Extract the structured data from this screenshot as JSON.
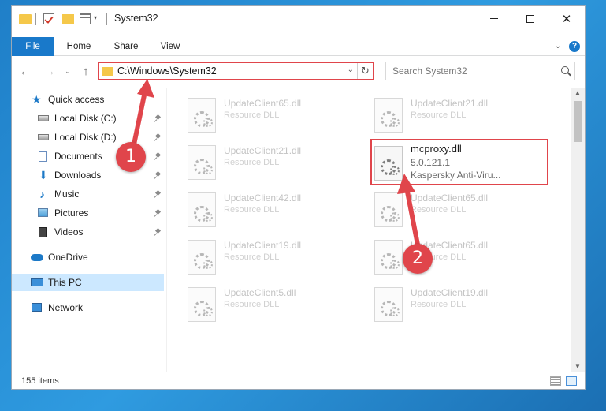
{
  "window": {
    "title": "System32",
    "minimize_icon": "minimize-icon",
    "maximize_icon": "maximize-icon",
    "close_glyph": "✕"
  },
  "ribbon": {
    "tabs": [
      {
        "label": "File"
      },
      {
        "label": "Home"
      },
      {
        "label": "Share"
      },
      {
        "label": "View"
      }
    ],
    "help": "?"
  },
  "nav": {
    "address": "C:\\Windows\\System32",
    "search_placeholder": "Search System32"
  },
  "sidebar": {
    "items": [
      {
        "label": "Quick access",
        "icon": "star-icon"
      },
      {
        "label": "Local Disk (C:)",
        "icon": "drive-icon",
        "pinned": true
      },
      {
        "label": "Local Disk (D:)",
        "icon": "drive-icon",
        "pinned": true
      },
      {
        "label": "Documents",
        "icon": "documents-icon",
        "pinned": true
      },
      {
        "label": "Downloads",
        "icon": "downloads-icon",
        "pinned": true
      },
      {
        "label": "Music",
        "icon": "music-icon",
        "pinned": true
      },
      {
        "label": "Pictures",
        "icon": "pictures-icon",
        "pinned": true
      },
      {
        "label": "Videos",
        "icon": "videos-icon",
        "pinned": true
      },
      {
        "label": "OneDrive",
        "icon": "onedrive-icon"
      },
      {
        "label": "This PC",
        "icon": "computer-icon",
        "selected": true
      },
      {
        "label": "Network",
        "icon": "network-icon"
      }
    ]
  },
  "files": [
    {
      "name": "UpdateClient65.dll",
      "type": "Resource DLL"
    },
    {
      "name": "UpdateClient21.dll",
      "type": "Resource DLL"
    },
    {
      "name": "UpdateClient21.dll",
      "type": "Resource DLL"
    },
    {
      "name": "mcproxy.dll",
      "version": "5.0.121.1",
      "description": "Kaspersky Anti-Viru...",
      "highlighted": true
    },
    {
      "name": "UpdateClient42.dll",
      "type": "Resource DLL"
    },
    {
      "name": "UpdateClient65.dll",
      "type": "Resource DLL"
    },
    {
      "name": "UpdateClient19.dll",
      "type": "Resource DLL"
    },
    {
      "name": "UpdateClient65.dll",
      "type": "Resource DLL"
    },
    {
      "name": "UpdateClient5.dll",
      "type": "Resource DLL"
    },
    {
      "name": "UpdateClient19.dll",
      "type": "Resource DLL"
    }
  ],
  "status": {
    "item_count": "155 items"
  },
  "callouts": [
    {
      "label": "1"
    },
    {
      "label": "2"
    }
  ],
  "colors": {
    "accent": "#1979ca",
    "highlight": "#e0454b",
    "selected": "#cce8ff"
  }
}
